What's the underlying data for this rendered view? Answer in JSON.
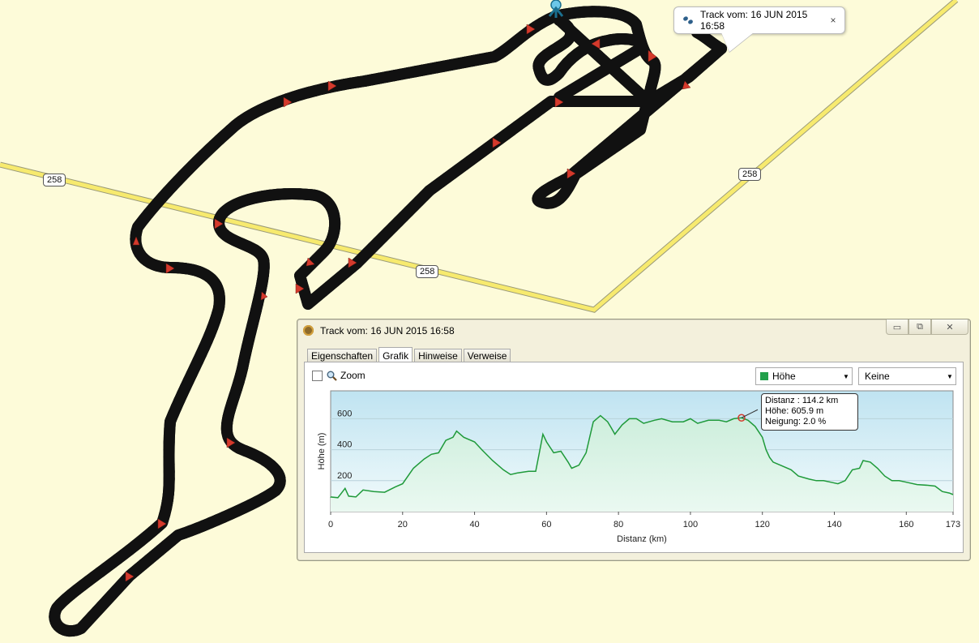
{
  "map": {
    "road_labels": [
      "258",
      "258",
      "258"
    ],
    "colors": {
      "background": "#fdfbd9",
      "road": "#f7ea6e",
      "track_outline": "#111111",
      "track_fill": "#f3e324",
      "arrow": "#d43a2c"
    }
  },
  "map_tooltip": {
    "icon": "track-footprints-icon",
    "text": "Track vom: 16 JUN 2015 16:58",
    "close": "×"
  },
  "window": {
    "title": "Track vom: 16 JUN 2015 16:58",
    "buttons": {
      "minimize": "▭",
      "restore": "⧉",
      "close": "✕"
    },
    "tabs": [
      "Eigenschaften",
      "Grafik",
      "Hinweise",
      "Verweise"
    ],
    "active_tab": "Grafik",
    "zoom_label": "Zoom",
    "select_primary": "Höhe",
    "select_secondary": "Keine"
  },
  "tooltip": {
    "line1": "Distanz : 114.2 km",
    "line2": "Höhe: 605.9 m",
    "line3": "Neigung: 2.0 %"
  },
  "chart_data": {
    "type": "area",
    "xlabel": "Distanz  (km)",
    "ylabel": "Höhe (m)",
    "xlim": [
      0,
      173
    ],
    "ylim": [
      0,
      780
    ],
    "x_ticks": [
      0,
      20,
      40,
      60,
      80,
      100,
      120,
      140,
      160,
      173
    ],
    "y_ticks": [
      200,
      400,
      600
    ],
    "grid": true,
    "series": [
      {
        "color": "#1f9a3a",
        "points": [
          [
            0,
            95
          ],
          [
            2,
            90
          ],
          [
            4,
            150
          ],
          [
            5,
            100
          ],
          [
            7,
            95
          ],
          [
            9,
            140
          ],
          [
            12,
            130
          ],
          [
            15,
            125
          ],
          [
            18,
            160
          ],
          [
            20,
            180
          ],
          [
            23,
            280
          ],
          [
            26,
            340
          ],
          [
            28,
            370
          ],
          [
            30,
            380
          ],
          [
            32,
            460
          ],
          [
            34,
            480
          ],
          [
            35,
            520
          ],
          [
            37,
            480
          ],
          [
            40,
            450
          ],
          [
            42,
            400
          ],
          [
            45,
            330
          ],
          [
            48,
            270
          ],
          [
            50,
            240
          ],
          [
            52,
            250
          ],
          [
            55,
            260
          ],
          [
            57,
            260
          ],
          [
            58,
            380
          ],
          [
            59,
            500
          ],
          [
            60,
            450
          ],
          [
            62,
            380
          ],
          [
            64,
            390
          ],
          [
            66,
            320
          ],
          [
            67,
            280
          ],
          [
            69,
            300
          ],
          [
            71,
            380
          ],
          [
            72,
            480
          ],
          [
            73,
            580
          ],
          [
            75,
            620
          ],
          [
            77,
            580
          ],
          [
            78,
            540
          ],
          [
            79,
            500
          ],
          [
            81,
            560
          ],
          [
            83,
            600
          ],
          [
            85,
            600
          ],
          [
            87,
            570
          ],
          [
            90,
            590
          ],
          [
            92,
            600
          ],
          [
            95,
            580
          ],
          [
            98,
            580
          ],
          [
            100,
            600
          ],
          [
            102,
            570
          ],
          [
            105,
            590
          ],
          [
            108,
            590
          ],
          [
            110,
            580
          ],
          [
            112,
            600
          ],
          [
            114.2,
            605.9
          ],
          [
            116,
            590
          ],
          [
            118,
            550
          ],
          [
            120,
            480
          ],
          [
            121,
            400
          ],
          [
            122,
            350
          ],
          [
            123,
            320
          ],
          [
            125,
            300
          ],
          [
            128,
            270
          ],
          [
            130,
            230
          ],
          [
            133,
            210
          ],
          [
            135,
            200
          ],
          [
            137,
            200
          ],
          [
            139,
            190
          ],
          [
            141,
            180
          ],
          [
            143,
            200
          ],
          [
            145,
            270
          ],
          [
            147,
            280
          ],
          [
            148,
            330
          ],
          [
            150,
            320
          ],
          [
            152,
            280
          ],
          [
            154,
            230
          ],
          [
            156,
            200
          ],
          [
            158,
            200
          ],
          [
            160,
            190
          ],
          [
            163,
            175
          ],
          [
            166,
            170
          ],
          [
            168,
            165
          ],
          [
            170,
            130
          ],
          [
            172,
            120
          ],
          [
            173,
            110
          ]
        ],
        "marker": {
          "x": 114.2,
          "y": 605.9
        }
      }
    ]
  }
}
